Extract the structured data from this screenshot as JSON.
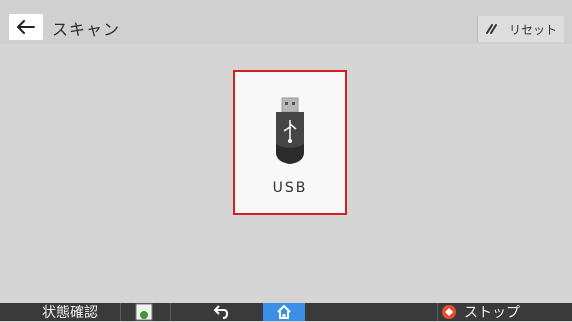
{
  "header": {
    "title": "スキャン",
    "reset_label": "リセット"
  },
  "main": {
    "usb_label": "USB"
  },
  "footer": {
    "status_label": "状態確認",
    "stop_label": "ストップ"
  },
  "colors": {
    "highlight_border": "#d31f1f",
    "home_button": "#3b8fe6",
    "stop_icon": "#e94b2e",
    "bottom_bar": "#3a3a3a"
  },
  "icons": {
    "back": "back-arrow-icon",
    "reset": "reset-icon",
    "usb": "usb-drive-icon",
    "status": "device-status-icon",
    "undo": "undo-arrow-icon",
    "home": "home-icon",
    "stop": "stop-icon"
  }
}
